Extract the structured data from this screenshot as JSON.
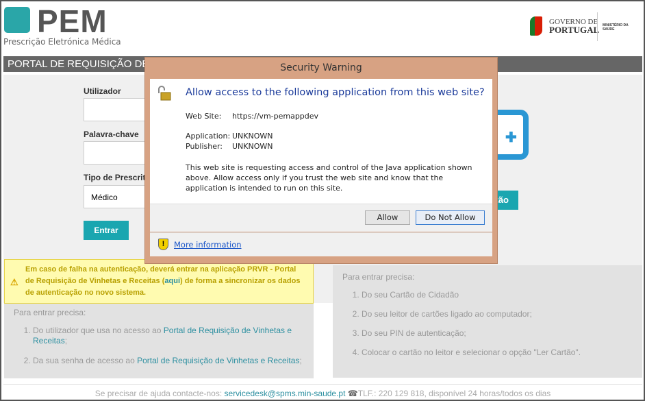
{
  "header": {
    "logo": "PEM",
    "logo_subtitle": "Prescrição Eletrónica Médica",
    "gov_line1": "GOVERNO DE",
    "gov_line2": "PORTUGAL",
    "ministry": "MINISTÉRIO DA SAÚDE"
  },
  "title_bar": "PORTAL DE REQUISIÇÃO DE VINHETAS E RECEITAS",
  "login": {
    "user_label": "Utilizador",
    "user_value": "",
    "password_label": "Palavra-chave",
    "password_value": "",
    "type_label": "Tipo de Prescritor",
    "type_value": "Médico",
    "submit": "Entrar"
  },
  "card_login": {
    "button": "Ler Cartão"
  },
  "warning": {
    "text1": "Em caso de falha na autenticação, deverá entrar na aplicação PRVR - Portal de Requisição de Vinhetas e Receitas (",
    "link": "aqui",
    "text2": ") de forma a sincronizar os dados de autenticação no novo sistema."
  },
  "left_panel": {
    "title": "Para entrar precisa:",
    "items": [
      {
        "pre": "Do utilizador que usa no acesso ao ",
        "link": "Portal de Requisição de Vinhetas e Receitas",
        "post": ";"
      },
      {
        "pre": "Da sua senha de acesso ao ",
        "link": "Portal de Requisição de Vinhetas e Receitas",
        "post": ";"
      }
    ]
  },
  "right_panel": {
    "title": "Para entrar precisa:",
    "items": [
      "Do seu Cartão de Cidadão",
      "Do seu leitor de cartões ligado ao computador;",
      "Do seu PIN de autenticação;",
      "Colocar o cartão no leitor e selecionar o opção \"Ler Cartão\"."
    ]
  },
  "footer": {
    "text": "Se precisar de ajuda contacte-nos: ",
    "email": "servicedesk@spms.min-saude.pt",
    "phone": "TLF.: 220 129 818, disponível 24 horas/todos os dias"
  },
  "dialog": {
    "title": "Security Warning",
    "question": "Allow access to the following application from this web site?",
    "website_label": "Web Site:",
    "website": "https://vm-pemappdev",
    "application_label": "Application:",
    "application": "UNKNOWN",
    "publisher_label": "Publisher:",
    "publisher": "UNKNOWN",
    "message": "This web site is requesting access and control of the Java application shown above. Allow access only if you trust the web site and know that the application is intended to run on this site.",
    "allow": "Allow",
    "deny": "Do Not Allow",
    "more_info": "More information"
  }
}
